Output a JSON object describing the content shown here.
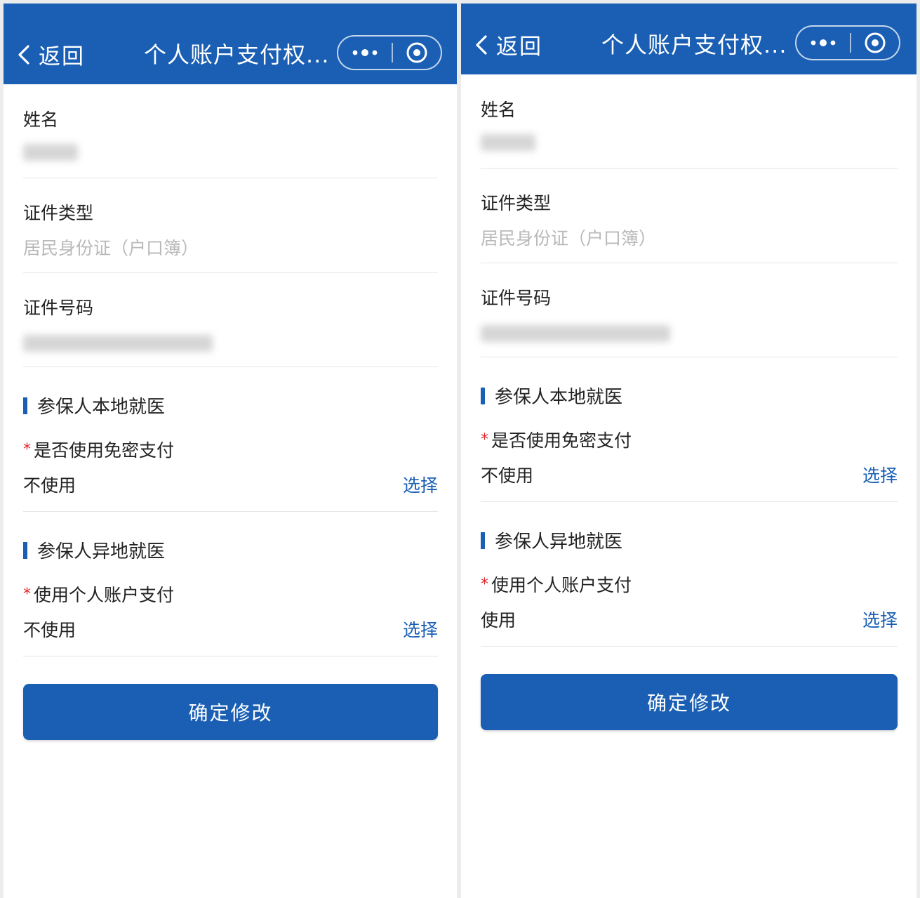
{
  "colors": {
    "brand": "#1a5fb4",
    "required": "#e0282e",
    "muted_text": "#b9b9b9"
  },
  "panels": [
    {
      "nav": {
        "back_label": "返回",
        "title": "个人账户支付权...",
        "more_icon": "more-dots-icon",
        "close_icon": "target-close-icon"
      },
      "fields": {
        "name_label": "姓名",
        "id_type_label": "证件类型",
        "id_type_value": "居民身份证（户口簿）",
        "id_number_label": "证件号码"
      },
      "local": {
        "section_title": "参保人本地就医",
        "required_mark": "*",
        "question": "是否使用免密支付",
        "value": "不使用",
        "select_label": "选择"
      },
      "remote": {
        "section_title": "参保人异地就医",
        "required_mark": "*",
        "question": "使用个人账户支付",
        "value": "不使用",
        "select_label": "选择"
      },
      "confirm_label": "确定修改"
    },
    {
      "nav": {
        "back_label": "返回",
        "title": "个人账户支付权...",
        "more_icon": "more-dots-icon",
        "close_icon": "target-close-icon"
      },
      "fields": {
        "name_label": "姓名",
        "id_type_label": "证件类型",
        "id_type_value": "居民身份证（户口簿）",
        "id_number_label": "证件号码"
      },
      "local": {
        "section_title": "参保人本地就医",
        "required_mark": "*",
        "question": "是否使用免密支付",
        "value": "不使用",
        "select_label": "选择"
      },
      "remote": {
        "section_title": "参保人异地就医",
        "required_mark": "*",
        "question": "使用个人账户支付",
        "value": "使用",
        "select_label": "选择"
      },
      "confirm_label": "确定修改"
    }
  ]
}
